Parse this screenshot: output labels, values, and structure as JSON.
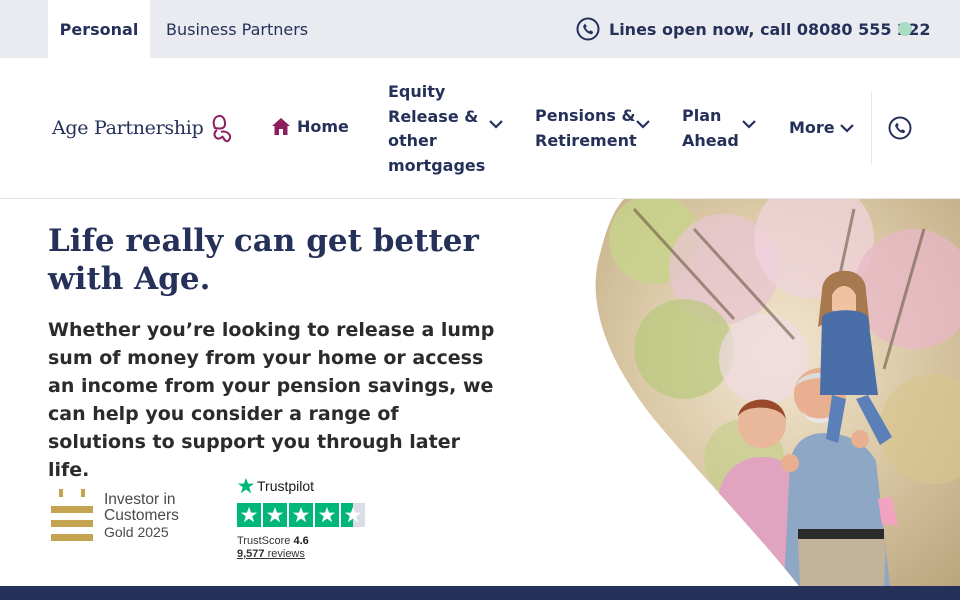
{
  "topbar": {
    "tabs": [
      {
        "label": "Personal",
        "active": true
      },
      {
        "label": "Business Partners",
        "active": false
      }
    ],
    "call_text": "Lines open now, call 08080 555 222",
    "status_color": "#a9dcc2"
  },
  "header": {
    "logo_text": "Age Partnership",
    "nav": {
      "home": "Home",
      "items": [
        {
          "lines": [
            "Equity",
            "Release &",
            "other",
            "mortgages"
          ]
        },
        {
          "lines": [
            "Pensions &",
            "Retirement"
          ]
        },
        {
          "lines": [
            "Plan",
            "Ahead"
          ]
        },
        {
          "lines": [
            "More"
          ]
        }
      ],
      "phone_icon": "phone-icon"
    }
  },
  "hero": {
    "title_line1": "Life really can get better",
    "title_line2": "with Age.",
    "body": "Whether you’re looking to release a lump sum of money from your home or access an income from your pension savings, we can help you consider a range of solutions to support you through later life."
  },
  "badges": {
    "investor": {
      "line1": "Investor in",
      "line2": "Customers",
      "line3": "Gold 2025"
    },
    "trustpilot": {
      "brand": "Trustpilot",
      "score_label": "TrustScore",
      "score": "4.6",
      "reviews_count": "9,577",
      "reviews_label": "reviews"
    }
  },
  "colors": {
    "brand_navy": "#26315a",
    "brand_plum": "#8c1d5e",
    "trustpilot_green": "#00b67a",
    "gold": "#c4a351"
  }
}
